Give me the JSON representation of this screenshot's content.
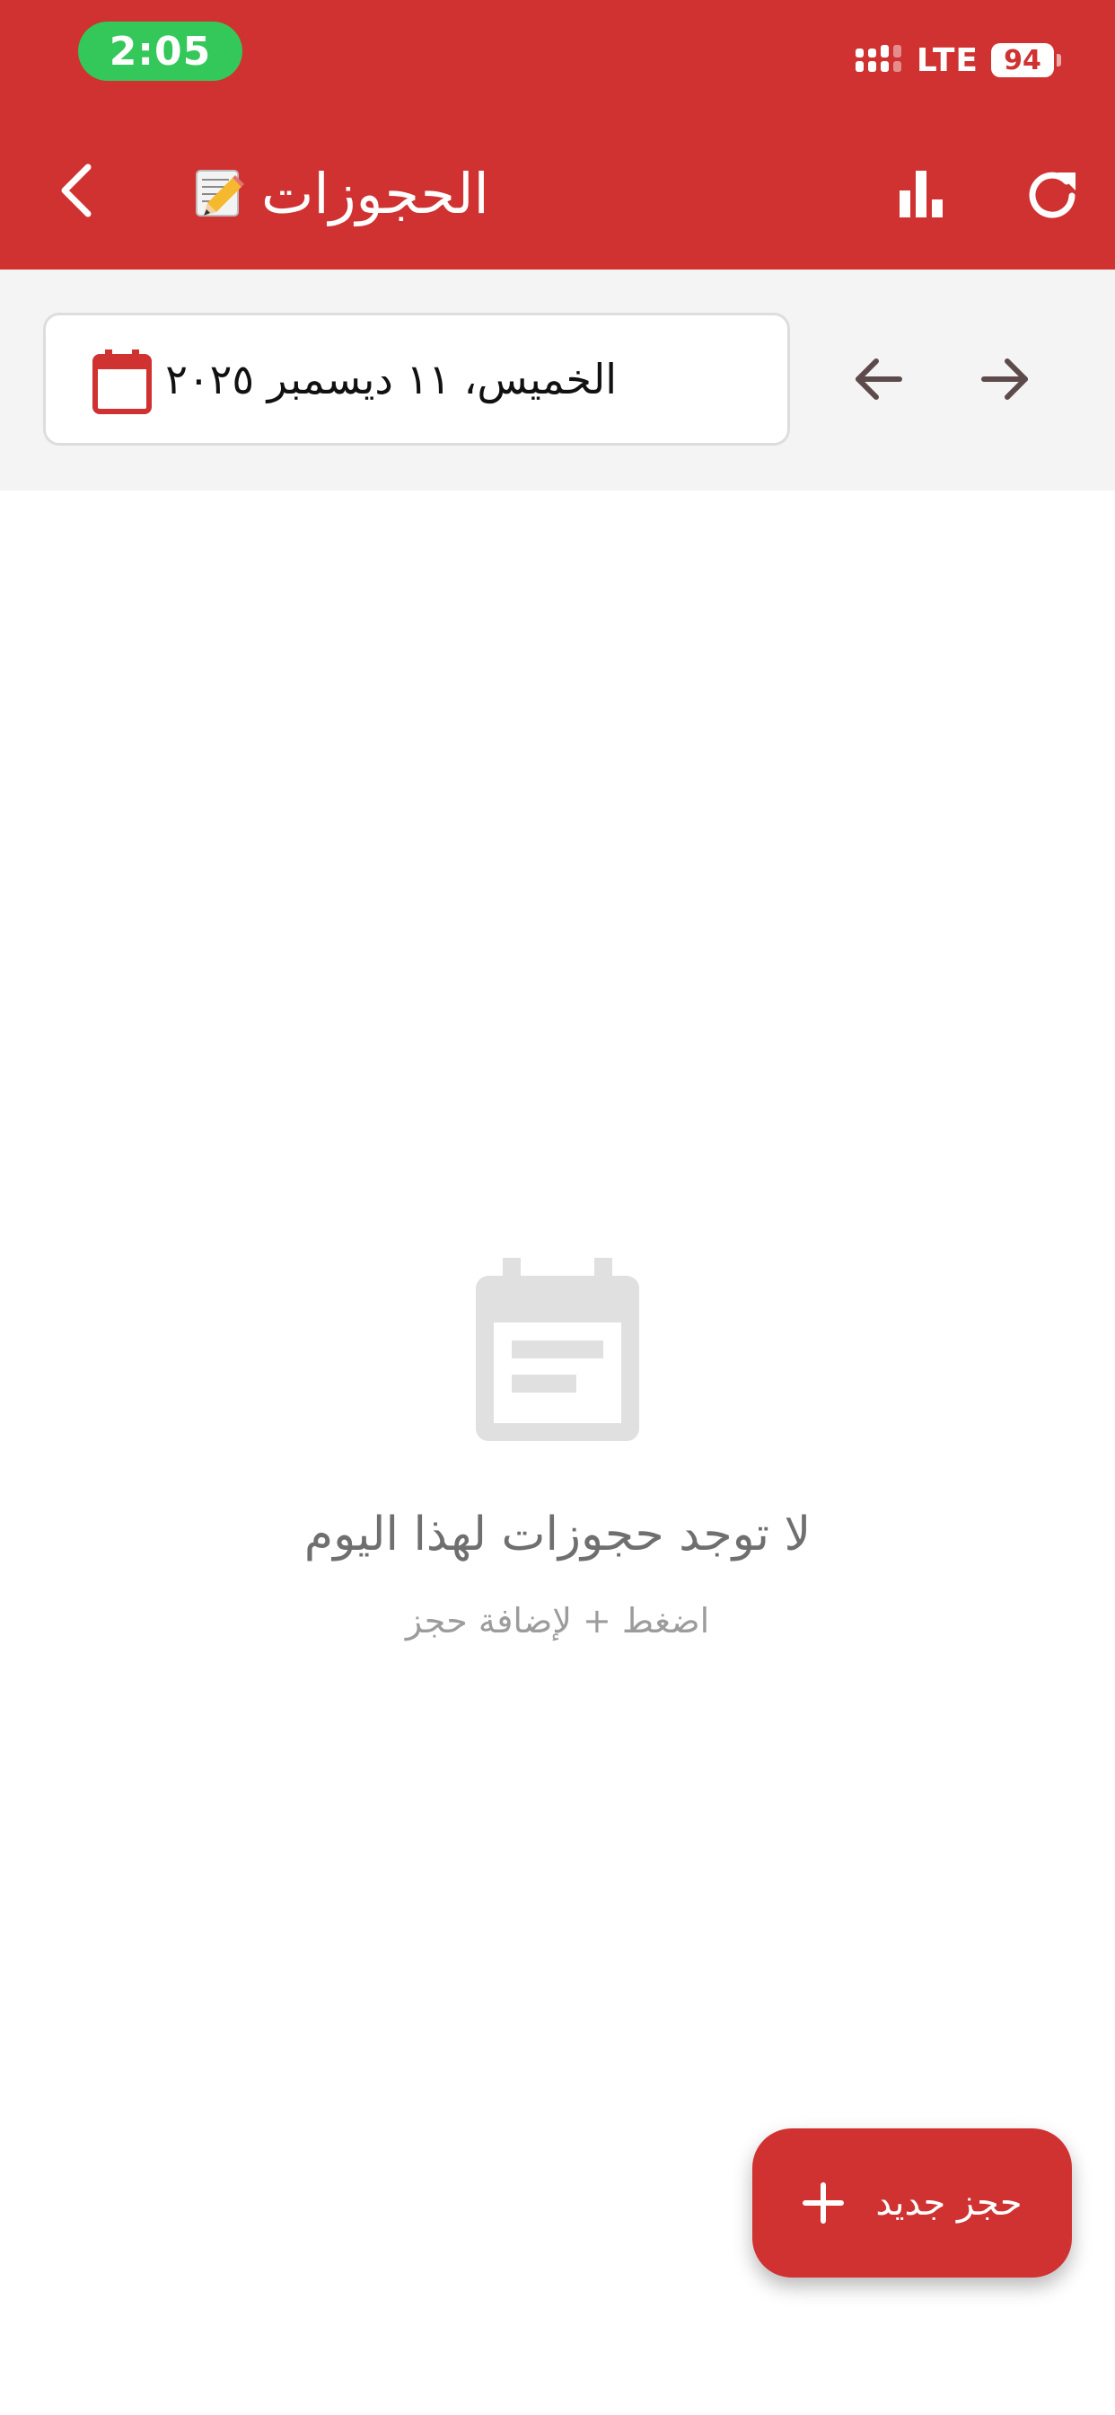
{
  "status_bar": {
    "time": "2:05",
    "network": "LTE",
    "battery": "94"
  },
  "app_bar": {
    "title": "الحجوزات"
  },
  "date_bar": {
    "date": "الخميس، ١١ ديسمبر ٢٠٢٥"
  },
  "empty_state": {
    "title": "لا توجد حجوزات لهذا اليوم",
    "subtitle": "اضغط + لإضافة حجز"
  },
  "fab": {
    "label": "حجز جديد"
  },
  "colors": {
    "primary": "#d03131",
    "time_pill": "#34c759",
    "date_bar_bg": "#f4f4f4",
    "empty_icon": "#e0e0e0"
  },
  "icons": {
    "back": "chevron-left-icon",
    "title_emoji": "memo-icon",
    "stats": "bar-chart-icon",
    "refresh": "refresh-icon",
    "calendar": "calendar-icon",
    "prev": "arrow-left-icon",
    "next": "arrow-right-icon",
    "empty": "calendar-empty-icon",
    "add": "plus-icon"
  }
}
